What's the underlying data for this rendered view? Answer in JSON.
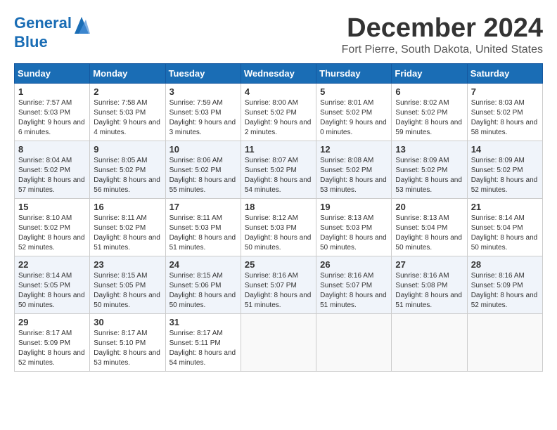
{
  "logo": {
    "line1": "General",
    "line2": "Blue"
  },
  "title": "December 2024",
  "location": "Fort Pierre, South Dakota, United States",
  "days_of_week": [
    "Sunday",
    "Monday",
    "Tuesday",
    "Wednesday",
    "Thursday",
    "Friday",
    "Saturday"
  ],
  "weeks": [
    [
      {
        "day": "1",
        "sunrise": "7:57 AM",
        "sunset": "5:03 PM",
        "daylight": "9 hours and 6 minutes."
      },
      {
        "day": "2",
        "sunrise": "7:58 AM",
        "sunset": "5:03 PM",
        "daylight": "9 hours and 4 minutes."
      },
      {
        "day": "3",
        "sunrise": "7:59 AM",
        "sunset": "5:03 PM",
        "daylight": "9 hours and 3 minutes."
      },
      {
        "day": "4",
        "sunrise": "8:00 AM",
        "sunset": "5:02 PM",
        "daylight": "9 hours and 2 minutes."
      },
      {
        "day": "5",
        "sunrise": "8:01 AM",
        "sunset": "5:02 PM",
        "daylight": "9 hours and 0 minutes."
      },
      {
        "day": "6",
        "sunrise": "8:02 AM",
        "sunset": "5:02 PM",
        "daylight": "8 hours and 59 minutes."
      },
      {
        "day": "7",
        "sunrise": "8:03 AM",
        "sunset": "5:02 PM",
        "daylight": "8 hours and 58 minutes."
      }
    ],
    [
      {
        "day": "8",
        "sunrise": "8:04 AM",
        "sunset": "5:02 PM",
        "daylight": "8 hours and 57 minutes."
      },
      {
        "day": "9",
        "sunrise": "8:05 AM",
        "sunset": "5:02 PM",
        "daylight": "8 hours and 56 minutes."
      },
      {
        "day": "10",
        "sunrise": "8:06 AM",
        "sunset": "5:02 PM",
        "daylight": "8 hours and 55 minutes."
      },
      {
        "day": "11",
        "sunrise": "8:07 AM",
        "sunset": "5:02 PM",
        "daylight": "8 hours and 54 minutes."
      },
      {
        "day": "12",
        "sunrise": "8:08 AM",
        "sunset": "5:02 PM",
        "daylight": "8 hours and 53 minutes."
      },
      {
        "day": "13",
        "sunrise": "8:09 AM",
        "sunset": "5:02 PM",
        "daylight": "8 hours and 53 minutes."
      },
      {
        "day": "14",
        "sunrise": "8:09 AM",
        "sunset": "5:02 PM",
        "daylight": "8 hours and 52 minutes."
      }
    ],
    [
      {
        "day": "15",
        "sunrise": "8:10 AM",
        "sunset": "5:02 PM",
        "daylight": "8 hours and 52 minutes."
      },
      {
        "day": "16",
        "sunrise": "8:11 AM",
        "sunset": "5:02 PM",
        "daylight": "8 hours and 51 minutes."
      },
      {
        "day": "17",
        "sunrise": "8:11 AM",
        "sunset": "5:03 PM",
        "daylight": "8 hours and 51 minutes."
      },
      {
        "day": "18",
        "sunrise": "8:12 AM",
        "sunset": "5:03 PM",
        "daylight": "8 hours and 50 minutes."
      },
      {
        "day": "19",
        "sunrise": "8:13 AM",
        "sunset": "5:03 PM",
        "daylight": "8 hours and 50 minutes."
      },
      {
        "day": "20",
        "sunrise": "8:13 AM",
        "sunset": "5:04 PM",
        "daylight": "8 hours and 50 minutes."
      },
      {
        "day": "21",
        "sunrise": "8:14 AM",
        "sunset": "5:04 PM",
        "daylight": "8 hours and 50 minutes."
      }
    ],
    [
      {
        "day": "22",
        "sunrise": "8:14 AM",
        "sunset": "5:05 PM",
        "daylight": "8 hours and 50 minutes."
      },
      {
        "day": "23",
        "sunrise": "8:15 AM",
        "sunset": "5:05 PM",
        "daylight": "8 hours and 50 minutes."
      },
      {
        "day": "24",
        "sunrise": "8:15 AM",
        "sunset": "5:06 PM",
        "daylight": "8 hours and 50 minutes."
      },
      {
        "day": "25",
        "sunrise": "8:16 AM",
        "sunset": "5:07 PM",
        "daylight": "8 hours and 51 minutes."
      },
      {
        "day": "26",
        "sunrise": "8:16 AM",
        "sunset": "5:07 PM",
        "daylight": "8 hours and 51 minutes."
      },
      {
        "day": "27",
        "sunrise": "8:16 AM",
        "sunset": "5:08 PM",
        "daylight": "8 hours and 51 minutes."
      },
      {
        "day": "28",
        "sunrise": "8:16 AM",
        "sunset": "5:09 PM",
        "daylight": "8 hours and 52 minutes."
      }
    ],
    [
      {
        "day": "29",
        "sunrise": "8:17 AM",
        "sunset": "5:09 PM",
        "daylight": "8 hours and 52 minutes."
      },
      {
        "day": "30",
        "sunrise": "8:17 AM",
        "sunset": "5:10 PM",
        "daylight": "8 hours and 53 minutes."
      },
      {
        "day": "31",
        "sunrise": "8:17 AM",
        "sunset": "5:11 PM",
        "daylight": "8 hours and 54 minutes."
      },
      null,
      null,
      null,
      null
    ]
  ],
  "labels": {
    "sunrise": "Sunrise:",
    "sunset": "Sunset:",
    "daylight": "Daylight:"
  }
}
